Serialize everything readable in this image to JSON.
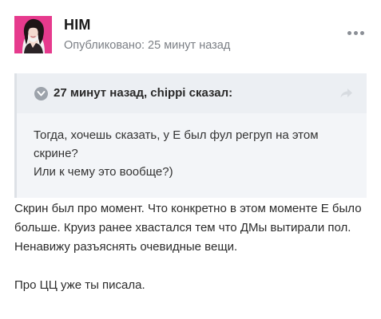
{
  "author": {
    "name": "HIM",
    "meta": "Опубликовано: 25 минут назад"
  },
  "quote": {
    "citation": "27 минут назад, chippi сказал:",
    "lines": [
      "Тогда, хочешь сказать, у Е был фул регруп на этом скрине?",
      "Или к чему это вообще?)"
    ]
  },
  "content": {
    "paragraphs": [
      "Скрин был про момент. Что конкретно в этом моменте Е было больше. Круиз ранее хвастался тем что ДМы вытирали пол. Ненавижу разъяснять очевидные вещи.",
      "Про ЦЦ уже ты писала."
    ]
  },
  "icons": {
    "avatar": "avatar-image",
    "more": "more-options-icon",
    "toggle": "chevron-down-icon",
    "share": "share-arrow-icon"
  },
  "colors": {
    "avatar_bg": "#e63a8d",
    "quote_bg": "#f3f5f8",
    "quote_head_bg": "#eceff3",
    "meta_text": "#7b7f85"
  }
}
